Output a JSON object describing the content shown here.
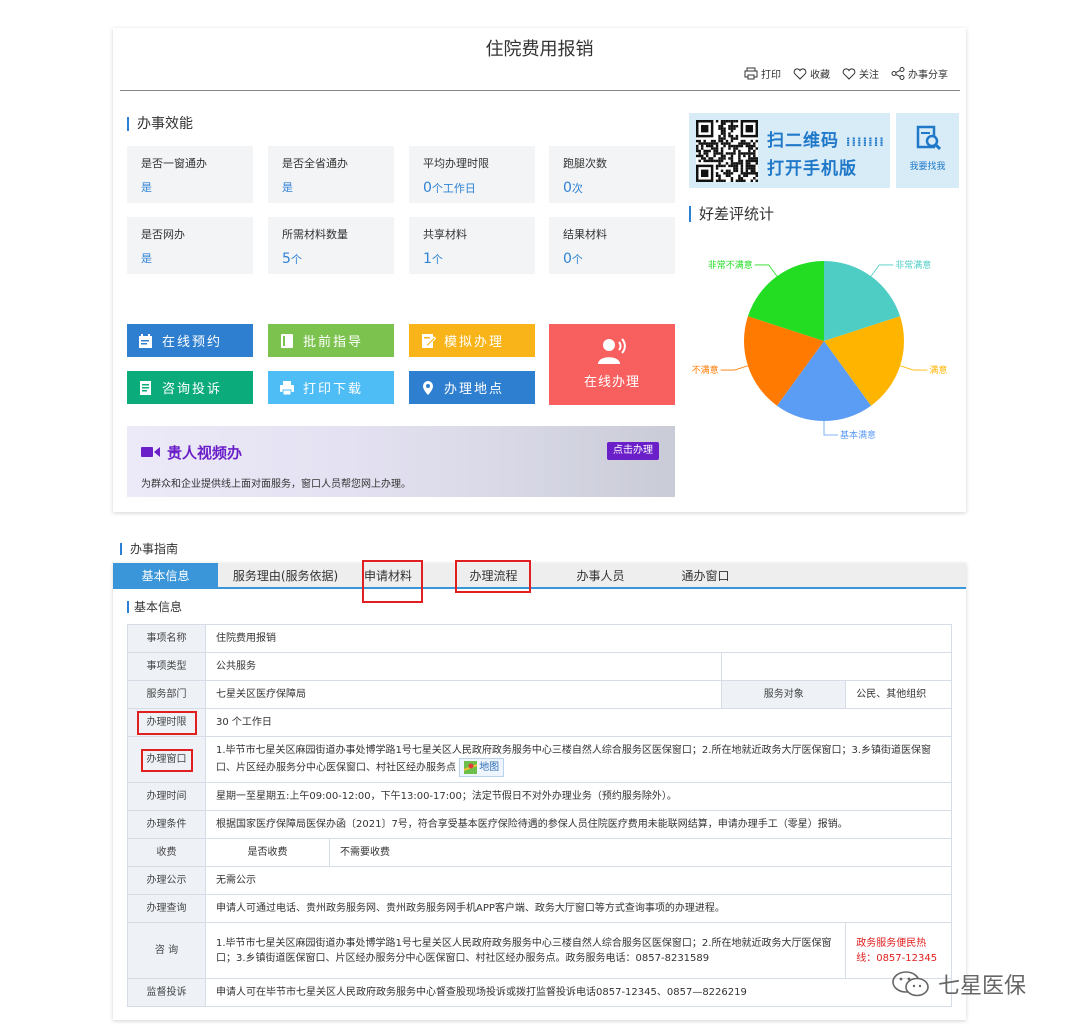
{
  "page": {
    "title": "住院费用报销"
  },
  "actions": [
    "打印",
    "收藏",
    "关注",
    "办事分享"
  ],
  "efficiency": {
    "heading": "办事效能",
    "stats": [
      {
        "label": "是否一窗通办",
        "value": "是",
        "unit": ""
      },
      {
        "label": "是否全省通办",
        "value": "是",
        "unit": ""
      },
      {
        "label": "平均办理时限",
        "value": "0",
        "unit": "个工作日"
      },
      {
        "label": "跑腿次数",
        "value": "0",
        "unit": "次"
      },
      {
        "label": "是否网办",
        "value": "是",
        "unit": ""
      },
      {
        "label": "所需材料数量",
        "value": "5",
        "unit": "个"
      },
      {
        "label": "共享材料",
        "value": "1",
        "unit": "个"
      },
      {
        "label": "结果材料",
        "value": "0",
        "unit": "个"
      }
    ]
  },
  "buttons": {
    "booking": "在线预约",
    "guide": "批前指导",
    "simulate": "模拟办理",
    "consult": "咨询投诉",
    "print": "打印下载",
    "location": "办理地点",
    "online": "在线办理"
  },
  "video": {
    "title": "贵人视频办",
    "subtitle": "为群众和企业提供线上面对面服务，窗口人员帮您网上办理。",
    "button": "点击办理"
  },
  "qr": {
    "line1": "扫二维码",
    "line2": "打开手机版",
    "find": "我要找我"
  },
  "rating": {
    "heading": "好差评统计",
    "colors": {
      "非常满意": "#4ecdc4",
      "满意": "#ffb400",
      "基本满意": "#5b9cf5",
      "不满意": "#ff7a00",
      "非常不满意": "#22dd22"
    }
  },
  "chart_data": {
    "type": "pie",
    "title": "好差评统计",
    "labels": [
      "非常满意",
      "满意",
      "基本满意",
      "不满意",
      "非常不满意"
    ],
    "values": [
      20,
      20,
      20,
      20,
      20
    ],
    "colors": [
      "#4ecdc4",
      "#ffb400",
      "#5b9cf5",
      "#ff7a00",
      "#22dd22"
    ]
  },
  "guide": {
    "heading": "办事指南",
    "tabs": [
      "基本信息",
      "服务理由(服务依据)",
      "申请材料",
      "办理流程",
      "办事人员",
      "通办窗口"
    ],
    "subheading": "基本信息",
    "rows": {
      "name_k": "事项名称",
      "name_v": "住院费用报销",
      "type_k": "事项类型",
      "type_v": "公共服务",
      "dept_k": "服务部门",
      "dept_v": "七星关区医疗保障局",
      "target_k": "服务对象",
      "target_v": "公民、其他组织",
      "limit_k": "办理时限",
      "limit_v": "30 个工作日",
      "window_k": "办理窗口",
      "window_v": "1.毕节市七星关区麻园街道办事处博学路1号七星关区人民政府政务服务中心三楼自然人综合服务区医保窗口；2.所在地就近政务大厅医保窗口；3.乡镇街道医保窗口、片区经办服务分中心医保窗口、村社区经办服务点",
      "map": "地图",
      "time_k": "办理时间",
      "time_v": "星期一至星期五:上午09:00-12:00，下午13:00-17:00；法定节假日不对外办理业务（预约服务除外）。",
      "cond_k": "办理条件",
      "cond_v": "根据国家医疗保障局医保办函〔2021〕7号，符合享受基本医疗保险待遇的参保人员住院医疗费用未能联网结算，申请办理手工（零星）报销。",
      "fee_k": "收费",
      "fee_q": "是否收费",
      "fee_v": "不需要收费",
      "pub_k": "办理公示",
      "pub_v": "无需公示",
      "query_k": "办理查询",
      "query_v": "申请人可通过电话、贵州政务服务网、贵州政务服务网手机APP客户端、政务大厅窗口等方式查询事项的办理进程。",
      "consult_k": "咨 询",
      "consult_v": "1.毕节市七星关区麻园街道办事处博学路1号七星关区人民政府政务服务中心三楼自然人综合服务区医保窗口；2.所在地就近政务大厅医保窗口；3.乡镇街道医保窗口、片区经办服务分中心医保窗口、村社区经办服务点。政务服务电话：0857-8231589",
      "hotline": "政务服务便民热线：0857-12345",
      "sup_k": "监督投诉",
      "sup_v": "申请人可在毕节市七星关区人民政府政务服务中心督查股现场投诉或拨打监督投诉电话0857-12345、0857—8226219"
    }
  },
  "watermark": "七星医保"
}
